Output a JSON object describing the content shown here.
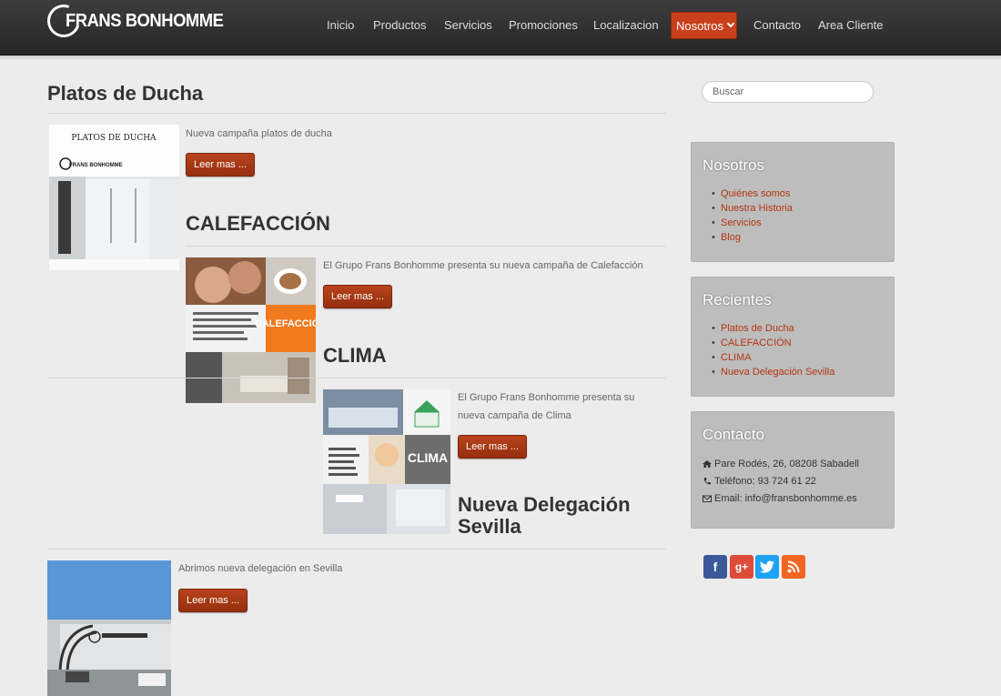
{
  "brand": {
    "logo_text": "FRANS BONHOMME"
  },
  "nav": {
    "items": [
      {
        "label": "Inicio"
      },
      {
        "label": "Productos"
      },
      {
        "label": "Servicios"
      },
      {
        "label": "Promociones"
      },
      {
        "label": "Localizacion"
      },
      {
        "label": "Nosotros",
        "active": true
      },
      {
        "label": "Contacto"
      },
      {
        "label": "Area Cliente"
      }
    ]
  },
  "main": {
    "page_title": "Platos de Ducha",
    "read_more_label": "Leer mas ...",
    "posts": [
      {
        "excerpt": "Nueva campaña platos de ducha",
        "thumb": {
          "heading": "PLATOS DE DUCHA",
          "logo": "FRANS BONHOMME"
        }
      },
      {
        "title": "CALEFACCIÓN",
        "excerpt": "El Grupo Frans Bonhomme presenta su nueva campaña de Calefacción",
        "thumb": {
          "banner": "CALEFACCIÓN"
        }
      },
      {
        "title": "CLIMA",
        "excerpt": "El Grupo Frans Bonhomme presenta su nueva campaña de Clima",
        "thumb": {
          "banner": "CLIMA"
        }
      },
      {
        "title": "Nueva Delegación Sevilla",
        "excerpt": "Abrimos nueva delegación en Sevilla",
        "thumb": {}
      }
    ]
  },
  "sidebar": {
    "search_placeholder": "Buscar",
    "nosotros": {
      "title": "Nosotros",
      "links": [
        "Quiénes somos",
        "Nuestra Historia",
        "Servicios",
        "Blog"
      ]
    },
    "recientes": {
      "title": "Recientes",
      "links": [
        "Platos de Ducha",
        "CALEFACCIÓN",
        "CLIMA",
        "Nueva Delegación Sevilla"
      ]
    },
    "contacto": {
      "title": "Contacto",
      "address": "Pare Rodés, 26, 08208 Sabadell",
      "phone": "Teléfono: 93 724 61 22",
      "email": "Email: info@fransbonhomme.es"
    },
    "social": [
      {
        "icon": "facebook-icon",
        "glyph": "f",
        "color": "#3b5998"
      },
      {
        "icon": "google-plus-icon",
        "glyph": "g+",
        "color": "#dd4b39"
      },
      {
        "icon": "twitter-icon",
        "glyph": "t",
        "color": "#1da1f2"
      },
      {
        "icon": "rss-icon",
        "glyph": "r",
        "color": "#f26522"
      }
    ]
  }
}
